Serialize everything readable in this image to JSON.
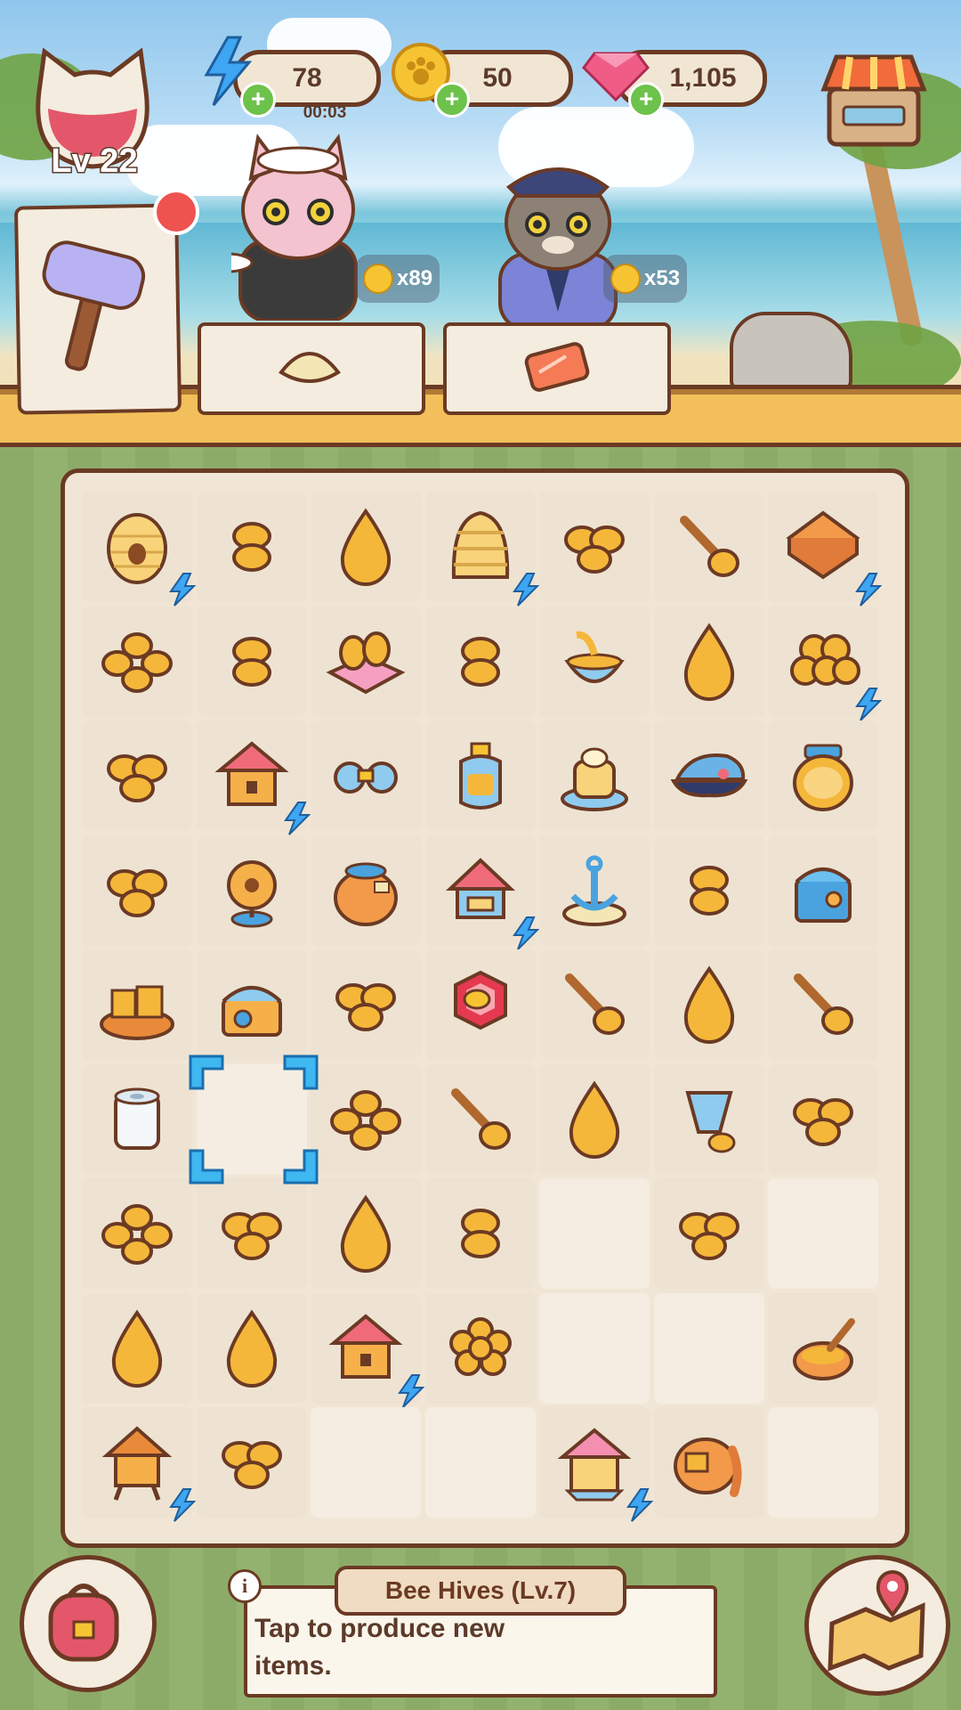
{
  "hud": {
    "energy": {
      "value": "78",
      "timer": "00:03",
      "icon": "lightning-icon"
    },
    "coins": {
      "value": "50",
      "icon": "paw-coin-icon"
    },
    "gems": {
      "value": "1,105",
      "icon": "gem-icon"
    },
    "level": "Lv 22"
  },
  "orders": [
    {
      "reward": "x89",
      "item": "dumpling-icon",
      "customer": "pink-maid-cat"
    },
    {
      "reward": "x53",
      "item": "salmon-icon",
      "customer": "police-cat"
    }
  ],
  "info": {
    "title": "Bee Hives (Lv.7)",
    "text": "Tap to produce new items."
  },
  "board": {
    "columns": 7,
    "rows": 9,
    "cells": [
      [
        "beehive-round-icon:bolt",
        "honey-coin-stack-icon",
        "honey-drop-icon",
        "beehive-skep-icon:bolt",
        "honeycomb-3-icon",
        "honey-dipper-icon",
        "honey-toast-icon:bolt"
      ],
      [
        "honeycomb-4-icon",
        "honey-coin-stack-icon",
        "hive-table-icon",
        "honey-coin-stack-icon",
        "honey-bowl-icon",
        "honey-drop-icon",
        "honeycomb-cluster-icon:bolt"
      ],
      [
        "honeycomb-3-icon",
        "bee-hut-icon:bolt",
        "binoculars-icon",
        "honey-bottle-icon",
        "honey-cake-icon",
        "captain-hat-icon",
        "honey-jar-icon"
      ],
      [
        "honeycomb-3-icon",
        "ship-wheel-lamp-icon",
        "honey-pot-icon",
        "bee-house-stack-icon:bolt",
        "anchor-icon",
        "honey-coin-stack-icon",
        "blue-chest-icon"
      ],
      [
        "honeycomb-platter-icon",
        "treasure-chest-icon",
        "honeycomb-3-icon",
        "bee-honeycomb-icon",
        "honey-dipper-icon",
        "honey-drop-icon",
        "honey-dipper-icon"
      ],
      [
        "toilet-paper-icon",
        "empty-selected",
        "honeycomb-4-icon",
        "honey-dipper-icon",
        "honey-drop-icon",
        "honey-cup-icon",
        "honeycomb-3-icon"
      ],
      [
        "honeycomb-4-icon",
        "honeycomb-3-icon",
        "honey-drop-icon",
        "honey-coin-stack-icon",
        "empty",
        "honeycomb-3-icon",
        "empty"
      ],
      [
        "honey-drop-icon",
        "honey-drop-icon",
        "bee-hut-icon:bolt",
        "honeycomb-flower-icon",
        "empty",
        "empty",
        "honey-bowl-spoon-icon"
      ],
      [
        "bee-hive-box-icon:bolt",
        "honeycomb-3-icon",
        "empty",
        "empty",
        "bee-house-pink-icon:bolt",
        "honey-pot-spill-icon",
        "empty"
      ]
    ]
  },
  "colors": {
    "outline": "#6b3a24",
    "honey": "#f5b73a",
    "accent": "#ef5350",
    "energy": "#3ea6f2"
  }
}
